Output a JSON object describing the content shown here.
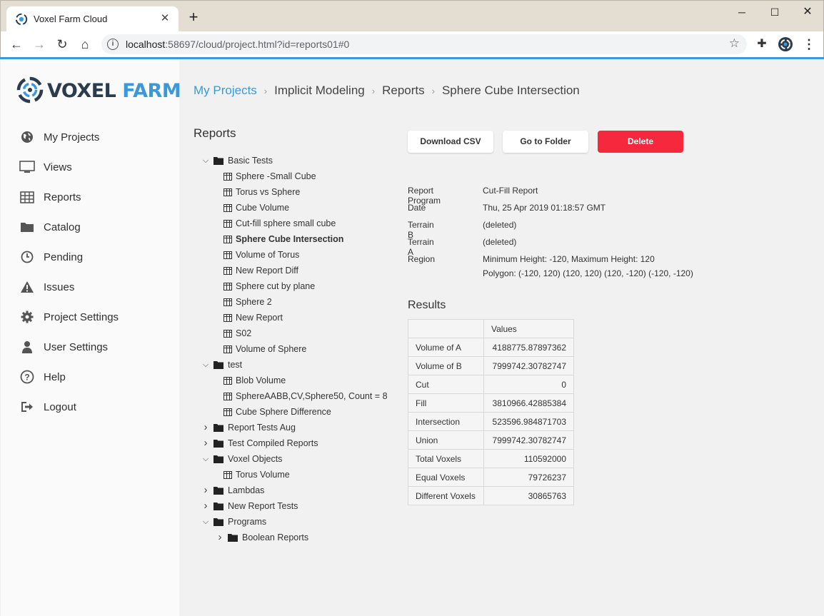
{
  "browser": {
    "tab_title": "Voxel Farm Cloud",
    "url_host": "localhost",
    "url_rest": ":58697/cloud/project.html?id=reports01#0"
  },
  "logo": {
    "word1": "VOXEL",
    "word2": "FARM"
  },
  "sidebar": {
    "items": [
      {
        "label": "My Projects",
        "icon": "globe-icon"
      },
      {
        "label": "Views",
        "icon": "monitor-icon"
      },
      {
        "label": "Reports",
        "icon": "table-icon"
      },
      {
        "label": "Catalog",
        "icon": "folder-icon"
      },
      {
        "label": "Pending",
        "icon": "clock-icon"
      },
      {
        "label": "Issues",
        "icon": "warning-icon"
      },
      {
        "label": "Project Settings",
        "icon": "gear-icon"
      },
      {
        "label": "User Settings",
        "icon": "user-icon"
      },
      {
        "label": "Help",
        "icon": "help-icon"
      },
      {
        "label": "Logout",
        "icon": "logout-icon"
      }
    ]
  },
  "breadcrumb": [
    "My Projects",
    "Implicit Modeling",
    "Reports",
    "Sphere Cube Intersection"
  ],
  "reports_title": "Reports",
  "tree": [
    {
      "label": "Basic Tests",
      "type": "folder",
      "level": 0,
      "toggle": "down"
    },
    {
      "label": "Sphere -Small Cube",
      "type": "report",
      "level": 1
    },
    {
      "label": "Torus vs Sphere",
      "type": "report",
      "level": 1
    },
    {
      "label": "Cube Volume",
      "type": "report",
      "level": 1
    },
    {
      "label": "Cut-fill sphere small cube",
      "type": "report",
      "level": 1
    },
    {
      "label": "Sphere Cube Intersection",
      "type": "report",
      "level": 1,
      "selected": true
    },
    {
      "label": "Volume of Torus",
      "type": "report",
      "level": 1
    },
    {
      "label": "New Report Diff",
      "type": "report",
      "level": 1
    },
    {
      "label": "Sphere cut by plane",
      "type": "report",
      "level": 1
    },
    {
      "label": "Sphere 2",
      "type": "report",
      "level": 1
    },
    {
      "label": "New Report",
      "type": "report",
      "level": 1
    },
    {
      "label": "S02",
      "type": "report",
      "level": 1
    },
    {
      "label": "Volume of Sphere",
      "type": "report",
      "level": 1
    },
    {
      "label": "test",
      "type": "folder",
      "level": 0,
      "toggle": "down"
    },
    {
      "label": "Blob Volume",
      "type": "report",
      "level": 1
    },
    {
      "label": "SphereAABB,CV,Sphere50, Count = 8",
      "type": "report",
      "level": 1
    },
    {
      "label": "Cube Sphere Difference",
      "type": "report",
      "level": 1
    },
    {
      "label": "Report Tests Aug",
      "type": "folder",
      "level": 0,
      "toggle": "right"
    },
    {
      "label": "Test Compiled Reports",
      "type": "folder",
      "level": 0,
      "toggle": "right"
    },
    {
      "label": "Voxel Objects",
      "type": "folder",
      "level": 0,
      "toggle": "down"
    },
    {
      "label": "Torus Volume",
      "type": "report",
      "level": 1
    },
    {
      "label": "Lambdas",
      "type": "folder",
      "level": 0,
      "toggle": "right"
    },
    {
      "label": "New Report Tests",
      "type": "folder",
      "level": 0,
      "toggle": "right"
    },
    {
      "label": "Programs",
      "type": "folder",
      "level": 0,
      "toggle": "down"
    },
    {
      "label": "Boolean Reports",
      "type": "folder",
      "level": 1,
      "toggle": "right"
    }
  ],
  "actions": {
    "download_csv": "Download CSV",
    "go_to_folder": "Go to Folder",
    "delete": "Delete",
    "delete_color": "#f5283d"
  },
  "details": [
    {
      "label": "Report Program",
      "value": "Cut-Fill Report"
    },
    {
      "label": "Date",
      "value": "Thu, 25 Apr 2019 01:18:57 GMT"
    },
    {
      "label": "Terrain B",
      "value": "(deleted)"
    },
    {
      "label": "Terrain A",
      "value": "(deleted)"
    },
    {
      "label": "Region",
      "value": "Minimum Height: -120, Maximum Height: 120",
      "value2": "Polygon: (-120, 120) (120, 120) (120, -120) (-120, -120)"
    }
  ],
  "results": {
    "title": "Results",
    "header": [
      "",
      "Values"
    ],
    "rows": [
      {
        "label": "Volume of A",
        "value": "4188775.87897362"
      },
      {
        "label": "Volume of B",
        "value": "7999742.30782747"
      },
      {
        "label": "Cut",
        "value": "0"
      },
      {
        "label": "Fill",
        "value": "3810966.42885384"
      },
      {
        "label": "Intersection",
        "value": "523596.984871703"
      },
      {
        "label": "Union",
        "value": "7999742.30782747"
      },
      {
        "label": "Total Voxels",
        "value": "110592000"
      },
      {
        "label": "Equal Voxels",
        "value": "79726237"
      },
      {
        "label": "Different Voxels",
        "value": "30865763"
      }
    ]
  },
  "colors": {
    "accent": "#3a9ad9",
    "logo_dark": "#2a3c4e"
  }
}
